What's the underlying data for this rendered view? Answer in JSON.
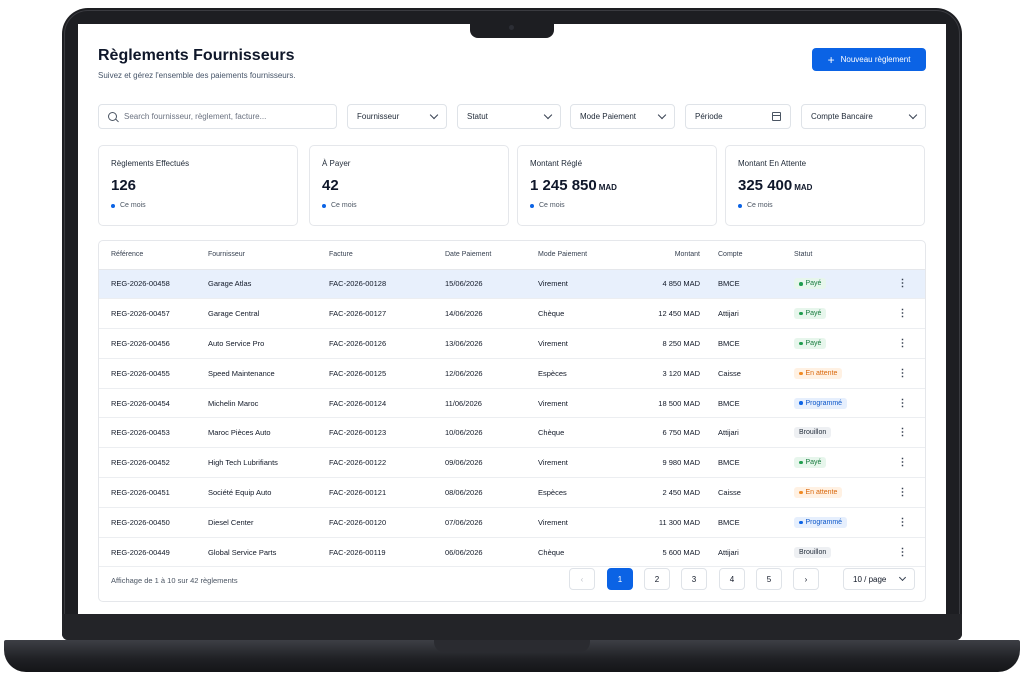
{
  "header": {
    "title": "Règlements Fournisseurs",
    "subtitle": "Suivez et gérez l'ensemble des paiements fournisseurs.",
    "new_button": "Nouveau règlement"
  },
  "filters": {
    "search_placeholder": "Search fournisseur, règlement, facture...",
    "supplier": "Fournisseur",
    "status": "Statut",
    "payment_mode": "Mode Paiement",
    "period": "Période",
    "bank_account": "Compte Bancaire"
  },
  "stats": [
    {
      "label": "Règlements Effectués",
      "value": "126",
      "unit": "",
      "foot": "Ce mois"
    },
    {
      "label": "À Payer",
      "value": "42",
      "unit": "",
      "foot": "Ce mois"
    },
    {
      "label": "Montant Réglé",
      "value": "1 245 850",
      "unit": "MAD",
      "foot": "Ce mois"
    },
    {
      "label": "Montant En Attente",
      "value": "325 400",
      "unit": "MAD",
      "foot": "Ce mois"
    }
  ],
  "table": {
    "columns": [
      "Référence",
      "Fournisseur",
      "Facture",
      "Date Paiement",
      "Mode Paiement",
      "Montant",
      "Compte",
      "Statut"
    ],
    "rows": [
      {
        "ref": "REG-2026-00458",
        "supplier": "Garage Atlas",
        "invoice": "FAC-2026-00128",
        "date": "15/06/2026",
        "mode": "Virement",
        "amount": "4 850 MAD",
        "account": "BMCE",
        "status": "Payé",
        "status_key": "paid"
      },
      {
        "ref": "REG-2026-00457",
        "supplier": "Garage Central",
        "invoice": "FAC-2026-00127",
        "date": "14/06/2026",
        "mode": "Chèque",
        "amount": "12 450 MAD",
        "account": "Attijari",
        "status": "Payé",
        "status_key": "paid"
      },
      {
        "ref": "REG-2026-00456",
        "supplier": "Auto Service Pro",
        "invoice": "FAC-2026-00126",
        "date": "13/06/2026",
        "mode": "Virement",
        "amount": "8 250 MAD",
        "account": "BMCE",
        "status": "Payé",
        "status_key": "paid"
      },
      {
        "ref": "REG-2026-00455",
        "supplier": "Speed Maintenance",
        "invoice": "FAC-2026-00125",
        "date": "12/06/2026",
        "mode": "Espèces",
        "amount": "3 120 MAD",
        "account": "Caisse",
        "status": "En attente",
        "status_key": "pending"
      },
      {
        "ref": "REG-2026-00454",
        "supplier": "Michelin Maroc",
        "invoice": "FAC-2026-00124",
        "date": "11/06/2026",
        "mode": "Virement",
        "amount": "18 500 MAD",
        "account": "BMCE",
        "status": "Programmé",
        "status_key": "scheduled"
      },
      {
        "ref": "REG-2026-00453",
        "supplier": "Maroc Pièces Auto",
        "invoice": "FAC-2026-00123",
        "date": "10/06/2026",
        "mode": "Chèque",
        "amount": "6 750 MAD",
        "account": "Attijari",
        "status": "Brouillon",
        "status_key": "draft"
      },
      {
        "ref": "REG-2026-00452",
        "supplier": "High Tech Lubrifiants",
        "invoice": "FAC-2026-00122",
        "date": "09/06/2026",
        "mode": "Virement",
        "amount": "9 980 MAD",
        "account": "BMCE",
        "status": "Payé",
        "status_key": "paid"
      },
      {
        "ref": "REG-2026-00451",
        "supplier": "Société Equip Auto",
        "invoice": "FAC-2026-00121",
        "date": "08/06/2026",
        "mode": "Espèces",
        "amount": "2 450 MAD",
        "account": "Caisse",
        "status": "En attente",
        "status_key": "pending"
      },
      {
        "ref": "REG-2026-00450",
        "supplier": "Diesel Center",
        "invoice": "FAC-2026-00120",
        "date": "07/06/2026",
        "mode": "Virement",
        "amount": "11 300 MAD",
        "account": "BMCE",
        "status": "Programmé",
        "status_key": "scheduled"
      },
      {
        "ref": "REG-2026-00449",
        "supplier": "Global Service Parts",
        "invoice": "FAC-2026-00119",
        "date": "06/06/2026",
        "mode": "Chèque",
        "amount": "5 600 MAD",
        "account": "Attijari",
        "status": "Brouillon",
        "status_key": "draft"
      }
    ]
  },
  "status_colors": {
    "paid": {
      "bg": "#e7f6ec",
      "fg": "#157a3c",
      "dot": "#1f9d4f"
    },
    "pending": {
      "bg": "#fff1e3",
      "fg": "#d9670b",
      "dot": "#f08a24"
    },
    "scheduled": {
      "bg": "#e6effd",
      "fg": "#0b56c9",
      "dot": "#0b63e5"
    },
    "draft": {
      "bg": "#eef0f3",
      "fg": "#1f2937",
      "dot": ""
    }
  },
  "pagination": {
    "summary": "Affichage de 1 à 10 sur 42 règlements",
    "pages": [
      "1",
      "2",
      "3",
      "4",
      "5"
    ],
    "current": "1",
    "prev": "‹",
    "next": "›",
    "per_page": "10 / page"
  },
  "colors": {
    "accent": "#0b63e5"
  },
  "icons": {
    "search": "search-icon",
    "calendar": "calendar-icon",
    "plus": "plus-icon",
    "chevron": "chevron-down-icon",
    "kebab": "more-vertical-icon"
  }
}
